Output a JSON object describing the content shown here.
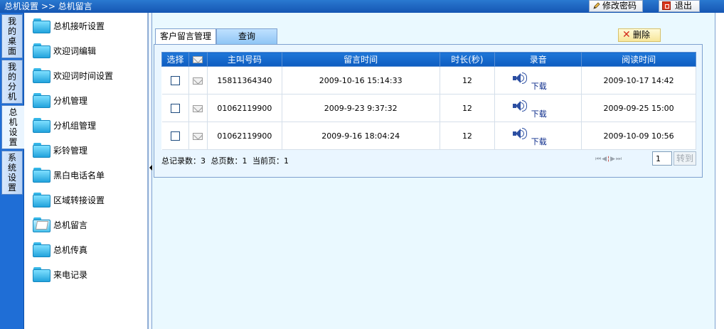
{
  "topbar": {
    "breadcrumb": [
      "总机设置",
      ">>",
      "总机留言"
    ],
    "change_password": "修改密码",
    "logout": "退出"
  },
  "vtabs": [
    "我的桌面",
    "我的分机",
    "总机设置",
    "系统设置"
  ],
  "active_vtab": "总机设置",
  "menu": {
    "items": [
      "总机接听设置",
      "欢迎词编辑",
      "欢迎词时间设置",
      "分机管理",
      "分机组管理",
      "彩铃管理",
      "黑白电话名单",
      "区域转接设置",
      "总机留言",
      "总机传真",
      "来电记录"
    ],
    "active": "总机留言"
  },
  "tabs": [
    "客户留言管理",
    "查询"
  ],
  "delete_button": "删除",
  "table": {
    "headers": [
      "选择",
      "",
      "主叫号码",
      "留言时间",
      "时长(秒)",
      "录音",
      "阅读时间"
    ],
    "rows": [
      {
        "caller": "15811364340",
        "time": "2009-10-16 15:14:33",
        "duration": "12",
        "download": "下载",
        "read": "2009-10-17 14:42"
      },
      {
        "caller": "01062119900",
        "time": "2009-9-23 9:37:32",
        "duration": "12",
        "download": "下载",
        "read": "2009-09-25 15:00"
      },
      {
        "caller": "01062119900",
        "time": "2009-9-16 18:04:24",
        "duration": "12",
        "download": "下载",
        "read": "2009-10-09 10:56"
      }
    ]
  },
  "summary": {
    "total_records": "总记录数：3",
    "total_pages": "总页数：1",
    "current_page": "当前页：1"
  },
  "pager": {
    "page_value": "1",
    "go": "转到"
  }
}
